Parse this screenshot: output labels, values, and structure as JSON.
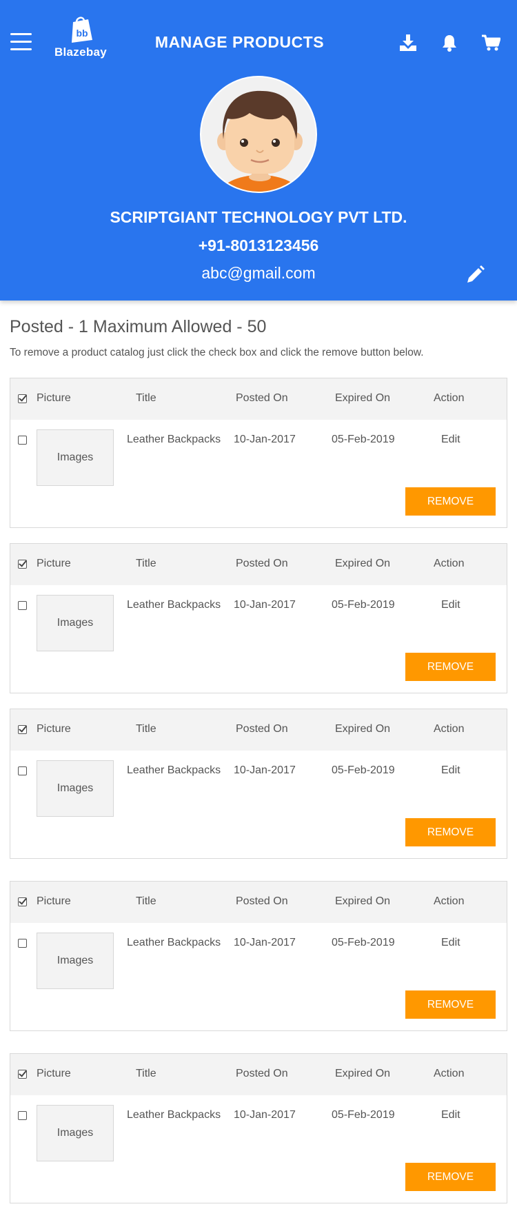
{
  "header": {
    "logo_text": "Blazebay",
    "title": "MANAGE PRODUCTS",
    "company": "SCRIPTGIANT TECHNOLOGY PVT LTD.",
    "phone": "+91-8013123456",
    "email": "abc@gmail.com",
    "icons": [
      "menu-icon",
      "download-icon",
      "bell-icon",
      "cart-icon",
      "pencil-icon"
    ]
  },
  "summary": {
    "posted_text": "Posted - 1 Maximum Allowed - 50",
    "instructions": "To remove a product catalog just click the check box and click the remove button below."
  },
  "table_headers": {
    "picture": "Picture",
    "title": "Title",
    "posted_on": "Posted On",
    "expired_on": "Expired On",
    "action": "Action"
  },
  "products": [
    {
      "image_label": "Images",
      "title": "Leather Backpacks",
      "posted_on": "10-Jan-2017",
      "expired_on": "05-Feb-2019",
      "action": "Edit",
      "remove_label": "REMOVE"
    },
    {
      "image_label": "Images",
      "title": "Leather Backpacks",
      "posted_on": "10-Jan-2017",
      "expired_on": "05-Feb-2019",
      "action": "Edit",
      "remove_label": "REMOVE"
    },
    {
      "image_label": "Images",
      "title": "Leather Backpacks",
      "posted_on": "10-Jan-2017",
      "expired_on": "05-Feb-2019",
      "action": "Edit",
      "remove_label": "REMOVE"
    },
    {
      "image_label": "Images",
      "title": "Leather Backpacks",
      "posted_on": "10-Jan-2017",
      "expired_on": "05-Feb-2019",
      "action": "Edit",
      "remove_label": "REMOVE"
    },
    {
      "image_label": "Images",
      "title": "Leather Backpacks",
      "posted_on": "10-Jan-2017",
      "expired_on": "05-Feb-2019",
      "action": "Edit",
      "remove_label": "REMOVE"
    }
  ],
  "colors": {
    "primary": "#2975ee",
    "accent": "#ff9800",
    "header_row": "#f3f3f3"
  }
}
